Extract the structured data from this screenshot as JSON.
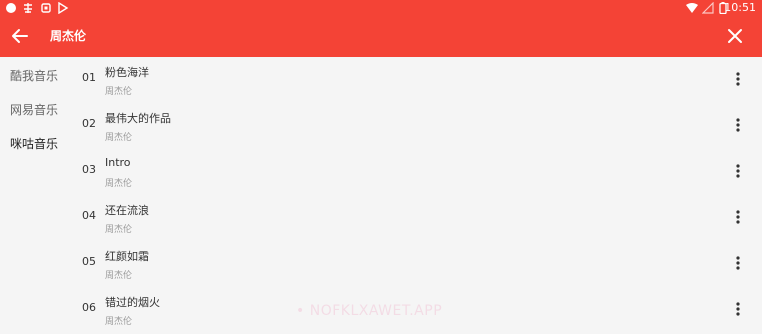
{
  "status_bar": {
    "time": "10:51"
  },
  "toolbar": {
    "title": "周杰伦"
  },
  "sidebar": {
    "items": [
      {
        "label": "酷我音乐"
      },
      {
        "label": "网易音乐"
      },
      {
        "label": "咪咕音乐"
      }
    ]
  },
  "songs": [
    {
      "num": "01",
      "title": "粉色海洋",
      "artist": "周杰伦"
    },
    {
      "num": "02",
      "title": "最伟大的作品",
      "artist": "周杰伦"
    },
    {
      "num": "03",
      "title": "Intro",
      "artist": "周杰伦"
    },
    {
      "num": "04",
      "title": "还在流浪",
      "artist": "周杰伦"
    },
    {
      "num": "05",
      "title": "红颜如霜",
      "artist": "周杰伦"
    },
    {
      "num": "06",
      "title": "错过的烟火",
      "artist": "周杰伦"
    }
  ],
  "watermark": "NOFKLXAWET.APP",
  "colors": {
    "accent": "#f44336",
    "background": "#f5f5f5"
  }
}
